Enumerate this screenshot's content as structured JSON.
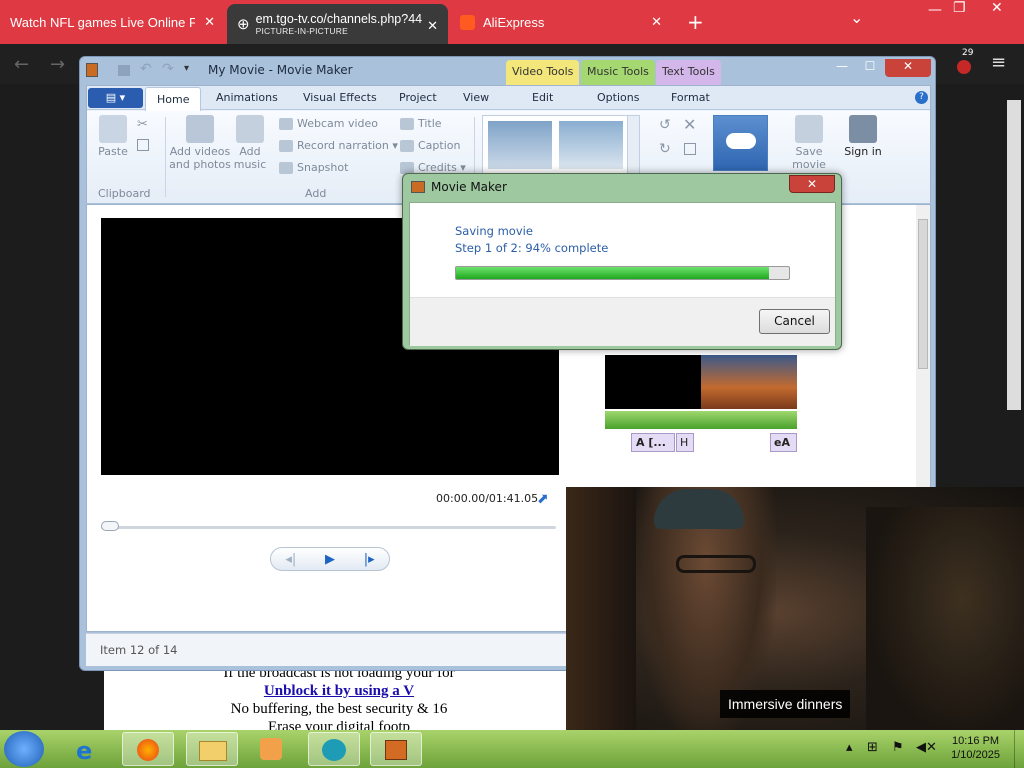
{
  "browser": {
    "tabs": [
      {
        "title": "Watch NFL games Live Online Free",
        "close": "✕"
      },
      {
        "title": "em.tgo-tv.co/channels.php?44",
        "subtitle": "PICTURE-IN-PICTURE",
        "close": "✕"
      },
      {
        "title": "AliExpress",
        "close": "✕"
      }
    ],
    "new_tab": "+",
    "tab_menu": "⌄",
    "back": "←",
    "forward": "→",
    "extension_badge": "29",
    "menu": "≡"
  },
  "page": {
    "line1": "If the broadcast is not loading your for",
    "link": "Unblock it by using a V",
    "line3": "No buffering, the best security & 16",
    "line4": "Erase your digital footp"
  },
  "moviemaker": {
    "window_title": "My Movie - Movie Maker",
    "contextual_tabs": [
      "Video Tools",
      "Music Tools",
      "Text Tools"
    ],
    "ribbon_tabs": [
      "Home",
      "Animations",
      "Visual Effects",
      "Project",
      "View",
      "Edit",
      "Options",
      "Format"
    ],
    "clipboard": {
      "paste": "Paste",
      "group": "Clipboard"
    },
    "add": {
      "add_videos": "Add videos and photos",
      "add_music": "Add music",
      "webcam": "Webcam video",
      "record": "Record narration",
      "snapshot": "Snapshot",
      "title": "Title",
      "caption": "Caption",
      "credits": "Credits",
      "group": "Add"
    },
    "save": "Save movie",
    "signin": "Sign in",
    "timecode": "00:00.00/01:41.05",
    "status": "Item 12 of 14",
    "story_labels": [
      "A [...",
      "H",
      "eA"
    ]
  },
  "dialog": {
    "title": "Movie Maker",
    "line1": "Saving movie",
    "line2": "Step 1 of 2: 94% complete",
    "progress": 0.94,
    "cancel": "Cancel"
  },
  "pip": {
    "caption": "Immersive dinners"
  },
  "taskbar": {
    "time": "10:16 PM",
    "date": "1/10/2025"
  },
  "colors": {
    "tabbar": "#df3a43",
    "ribbon_accent": "#2a5db0",
    "progress": "#1ea81e",
    "taskbar": "#8bc34a"
  }
}
